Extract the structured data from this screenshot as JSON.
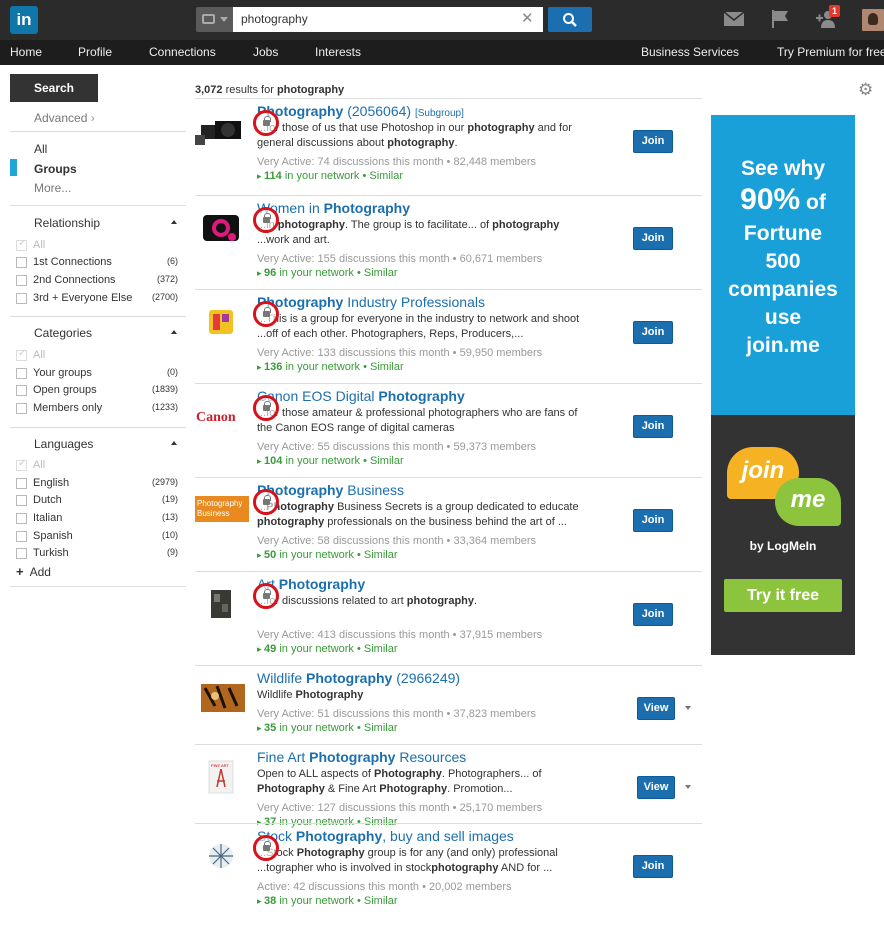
{
  "header": {
    "logo": "in",
    "search_value": "photography",
    "notification_count": "1"
  },
  "nav": [
    "Home",
    "Profile",
    "Connections",
    "Jobs",
    "Interests",
    "Business Services",
    "Try Premium for free"
  ],
  "sidebar": {
    "search_tab": "Search",
    "advanced": "Advanced",
    "types": [
      "All",
      "Groups",
      "More..."
    ],
    "filters": [
      {
        "title": "Relationship",
        "options": [
          {
            "label": "All",
            "count": ""
          },
          {
            "label": "1st Connections",
            "count": "(6)"
          },
          {
            "label": "2nd Connections",
            "count": "(372)"
          },
          {
            "label": "3rd + Everyone Else",
            "count": "(2700)"
          }
        ]
      },
      {
        "title": "Categories",
        "options": [
          {
            "label": "All",
            "count": ""
          },
          {
            "label": "Your groups",
            "count": "(0)"
          },
          {
            "label": "Open groups",
            "count": "(1839)"
          },
          {
            "label": "Members only",
            "count": "(1233)"
          }
        ]
      },
      {
        "title": "Languages",
        "options": [
          {
            "label": "All",
            "count": ""
          },
          {
            "label": "English",
            "count": "(2979)"
          },
          {
            "label": "Dutch",
            "count": "(19)"
          },
          {
            "label": "Italian",
            "count": "(13)"
          },
          {
            "label": "Spanish",
            "count": "(10)"
          },
          {
            "label": "Turkish",
            "count": "(9)"
          }
        ]
      }
    ],
    "add_label": "Add"
  },
  "results_summary": {
    "count": "3,072",
    "text": "results for",
    "query": "photography"
  },
  "results": [
    {
      "title_pre": "",
      "title_bold": "Photography",
      "title_post": " (2056064)",
      "tag": "[Subgroup]",
      "desc": "...for those of us that use Photoshop in our photography and for general discussions about photography.",
      "activity": "Very Active",
      "discussions": "74 discussions this month",
      "members": "82,448 members",
      "network": "114",
      "network_text": "in your network",
      "similar": "Similar",
      "button": "Join"
    },
    {
      "title_pre": "Women in ",
      "title_bold": "Photography",
      "title_post": "",
      "tag": "",
      "desc": "...in photography. The group is to facilitate... of photography ...work and art.",
      "activity": "Very Active",
      "discussions": "155 discussions this month",
      "members": "60,671 members",
      "network": "96",
      "network_text": "in your network",
      "similar": "Similar",
      "button": "Join"
    },
    {
      "title_pre": "",
      "title_bold": "Photography",
      "title_post": " Industry Professionals",
      "tag": "",
      "desc": "...This is a group for everyone in the industry to network and shoot ...off of each other. Photographers, Reps, Producers,...",
      "activity": "Very Active",
      "discussions": "133 discussions this month",
      "members": "59,950 members",
      "network": "136",
      "network_text": "in your network",
      "similar": "Similar",
      "button": "Join"
    },
    {
      "title_pre": "Canon EOS Digital ",
      "title_bold": "Photography",
      "title_post": "",
      "tag": "",
      "desc": "...for those amateur & professional photographers who are fans of the Canon EOS range of digital cameras",
      "activity": "Very Active",
      "discussions": "55 discussions this month",
      "members": "59,373 members",
      "network": "104",
      "network_text": "in your network",
      "similar": "Similar",
      "button": "Join"
    },
    {
      "title_pre": "",
      "title_bold": "Photography",
      "title_post": " Business",
      "tag": "",
      "desc": "...Photography Business Secrets is a group dedicated to educate photography professionals on the business behind the art of ...",
      "activity": "Very Active",
      "discussions": "58 discussions this month",
      "members": "33,364 members",
      "network": "50",
      "network_text": "in your network",
      "similar": "Similar",
      "button": "Join"
    },
    {
      "title_pre": "Art ",
      "title_bold": "Photography",
      "title_post": "",
      "tag": "",
      "desc": "...for discussions related to art photography.",
      "activity": "Very Active",
      "discussions": "413 discussions this month",
      "members": "37,915 members",
      "network": "49",
      "network_text": "in your network",
      "similar": "Similar",
      "button": "Join"
    },
    {
      "title_pre": "Wildlife ",
      "title_bold": "Photography",
      "title_post": " (2966249)",
      "tag": "",
      "desc": "Wildlife Photography",
      "activity": "Very Active",
      "discussions": "51 discussions this month",
      "members": "37,823 members",
      "network": "35",
      "network_text": "in your network",
      "similar": "Similar",
      "button": "View"
    },
    {
      "title_pre": "Fine Art ",
      "title_bold": "Photography",
      "title_post": " Resources",
      "tag": "",
      "desc": "Open to ALL aspects of Photography. Photographers... of Photography & Fine Art Photography. Promotion...",
      "activity": "Very Active",
      "discussions": "127 discussions this month",
      "members": "25,170 members",
      "network": "37",
      "network_text": "in your network",
      "similar": "Similar",
      "button": "View"
    },
    {
      "title_pre": "Stock ",
      "title_bold": "Photography",
      "title_post": ", buy and sell images",
      "tag": "",
      "desc": "...Stock Photography group is for any (and only) professional ...tographer who is involved in stockphotography AND for ...",
      "activity": "Active",
      "discussions": "42 discussions this month",
      "members": "20,002 members",
      "network": "38",
      "network_text": "in your network",
      "similar": "Similar",
      "button": "Join"
    }
  ],
  "ad": {
    "line1": "See why",
    "big": "90%",
    "of": "of",
    "line3": "Fortune",
    "line4": "500",
    "line5": "companies",
    "line6": "use",
    "line7": "join.me",
    "bubble1": "join",
    "bubble2": "me",
    "by": "by LogMeIn",
    "cta": "Try it free"
  },
  "colors": {
    "brand": "#0e76a8",
    "link": "#1c6fae",
    "network_green": "#3a9a3a",
    "annotation_red": "#d8121b",
    "ad_blue": "#1aa0d8"
  }
}
